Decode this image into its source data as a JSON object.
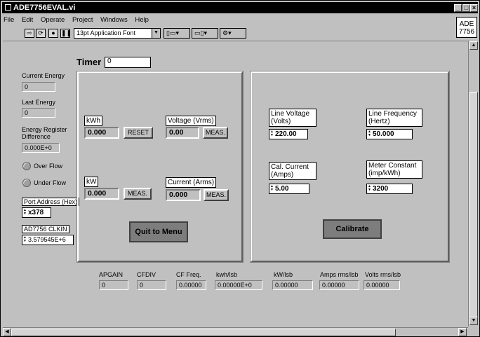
{
  "window": {
    "title": "ADE7756EVAL.vi",
    "icon_text": "ADE\n7756"
  },
  "menu": [
    "File",
    "Edit",
    "Operate",
    "Project",
    "Windows",
    "Help"
  ],
  "toolbar": {
    "font_selector": "13pt Application Font"
  },
  "timer": {
    "label": "Timer",
    "value": "0"
  },
  "left": {
    "current_energy": {
      "label": "Current Energy",
      "value": "0"
    },
    "last_energy": {
      "label": "Last Energy",
      "value": "0"
    },
    "energy_diff": {
      "label": "Energy Register\nDifference",
      "value": "0.000E+0"
    },
    "over_flow": "Over Flow",
    "under_flow": "Under Flow",
    "port_address": {
      "label": "Port Address (Hex)",
      "value": "x378"
    },
    "clkin": {
      "label": "AD7756 CLKIN",
      "value": "3.579545E+6"
    }
  },
  "measure": {
    "kwh": {
      "label": "kWh",
      "value": "0.000",
      "button": "RESET"
    },
    "voltage": {
      "label": "Voltage (Vrms)",
      "value": "0.00",
      "button": "MEAS."
    },
    "kw": {
      "label": "kW",
      "value": "0.000",
      "button": "MEAS."
    },
    "current": {
      "label": "Current (Arms)",
      "value": "0.000",
      "button": "MEAS."
    },
    "quit_button": "Quit to Menu"
  },
  "calibration": {
    "line_voltage": {
      "label": "Line Voltage\n(Volts)",
      "value": "220.00"
    },
    "line_frequency": {
      "label": "Line Frequency\n(Hertz)",
      "value": "50.000"
    },
    "cal_current": {
      "label": "Cal. Current\n(Amps)",
      "value": "5.00"
    },
    "meter_constant": {
      "label": "Meter Constant\n(imp/kWh)",
      "value": "3200"
    },
    "calibrate_button": "Calibrate"
  },
  "bottom": [
    {
      "label": "APGAIN",
      "value": "0"
    },
    {
      "label": "CFDIV",
      "value": "0"
    },
    {
      "label": "CF Freq.",
      "value": "0.00000"
    },
    {
      "label": "kwh/lsb",
      "value": "0.00000E+0"
    },
    {
      "label": "kW/lsb",
      "value": "0.00000"
    },
    {
      "label": "Amps rms/lsb",
      "value": "0.00000"
    },
    {
      "label": "Volts rms/lsb",
      "value": "0.00000"
    }
  ]
}
